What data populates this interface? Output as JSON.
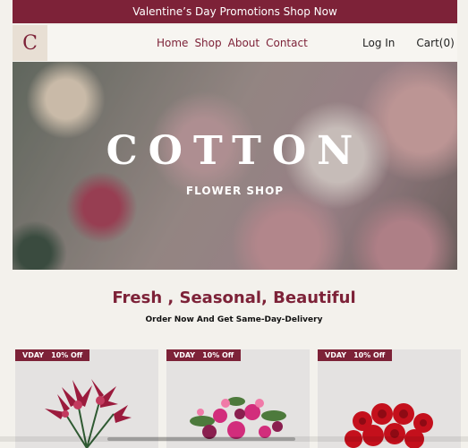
{
  "promo": {
    "text": "Valentine’s Day Promotions Shop Now"
  },
  "logo": {
    "letter": "C"
  },
  "nav": {
    "links": [
      "Home",
      "Shop",
      "About",
      "Contact"
    ],
    "login": "Log In",
    "cart": "Cart(0)"
  },
  "hero": {
    "title": "COTTON",
    "subtitle": "FLOWER SHOP"
  },
  "section": {
    "title": "Fresh , Seasonal, Beautiful",
    "subtitle": "Order Now And Get Same-Day-Delivery"
  },
  "products": [
    {
      "badge_code": "VDAY",
      "badge_discount": "10% Off",
      "image": "pink-lily-bouquet"
    },
    {
      "badge_code": "VDAY",
      "badge_discount": "10% Off",
      "image": "mixed-pink-bouquet"
    },
    {
      "badge_code": "VDAY",
      "badge_discount": "10% Off",
      "image": "red-rose-bouquet"
    }
  ],
  "colors": {
    "brand": "#7d2238",
    "background": "#f3f1ec"
  }
}
